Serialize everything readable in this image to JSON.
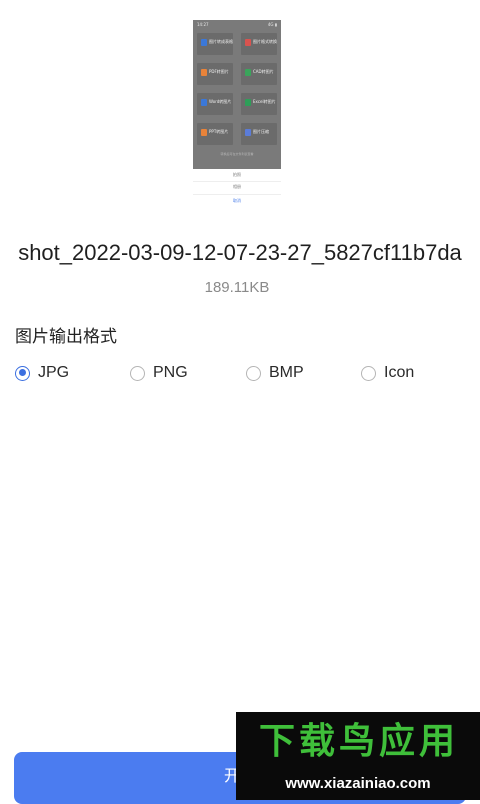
{
  "preview": {
    "status_time": "14:27",
    "status_right": "4G ▮",
    "tiles": [
      {
        "label": "图片转成表格",
        "icon_color": "#3b78d8"
      },
      {
        "label": "图片格式转换",
        "icon_color": "#d9534f"
      },
      {
        "label": "PDF转图片",
        "icon_color": "#e8833a"
      },
      {
        "label": "CAD转图片",
        "icon_color": "#3aa55b"
      },
      {
        "label": "Word转图片",
        "icon_color": "#3b78d8"
      },
      {
        "label": "Excel转图片",
        "icon_color": "#2e9e58"
      },
      {
        "label": "PPT转图片",
        "icon_color": "#e8833a"
      },
      {
        "label": "图片压缩",
        "icon_color": "#5b7cd8"
      }
    ],
    "note": "转换后可在文件列表查看",
    "sheet_options": [
      "拍照",
      "相册",
      "取消"
    ]
  },
  "file": {
    "name": "shot_2022-03-09-12-07-23-27_5827cf11b7da",
    "size": "189.11KB"
  },
  "output_format": {
    "title": "图片输出格式",
    "options": [
      "JPG",
      "PNG",
      "BMP",
      "Icon"
    ],
    "selected": "JPG"
  },
  "actions": {
    "start_label": "开始"
  },
  "watermark": {
    "title": "下载鸟应用",
    "url": "www.xiazainiao.com"
  },
  "colors": {
    "accent": "#4b7cf0",
    "radio_selected": "#3b6fe0",
    "watermark_green": "#3fbf3a"
  }
}
